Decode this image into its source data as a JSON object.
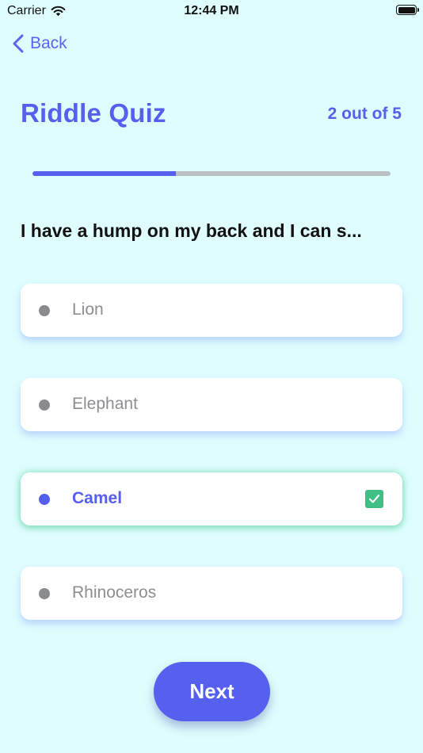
{
  "status_bar": {
    "carrier": "Carrier",
    "time": "12:44 PM"
  },
  "nav": {
    "back_label": "Back"
  },
  "quiz": {
    "title": "Riddle Quiz",
    "progress_text": "2 out of 5",
    "progress_fraction": 0.4,
    "question": "I have a hump on my back and I can s...",
    "options": [
      {
        "label": "Lion",
        "selected": false
      },
      {
        "label": "Elephant",
        "selected": false
      },
      {
        "label": "Camel",
        "selected": true
      },
      {
        "label": "Rhinoceros",
        "selected": false
      }
    ],
    "next_label": "Next"
  },
  "colors": {
    "background": "#dffdfd",
    "accent": "#5660ef",
    "correct": "#3fbf86",
    "option_text": "#8d8e91"
  },
  "icons": {
    "wifi": "wifi-icon",
    "battery": "battery-icon",
    "back": "chevron-left-icon",
    "selected_indicator": "checkbox-checked-icon"
  }
}
